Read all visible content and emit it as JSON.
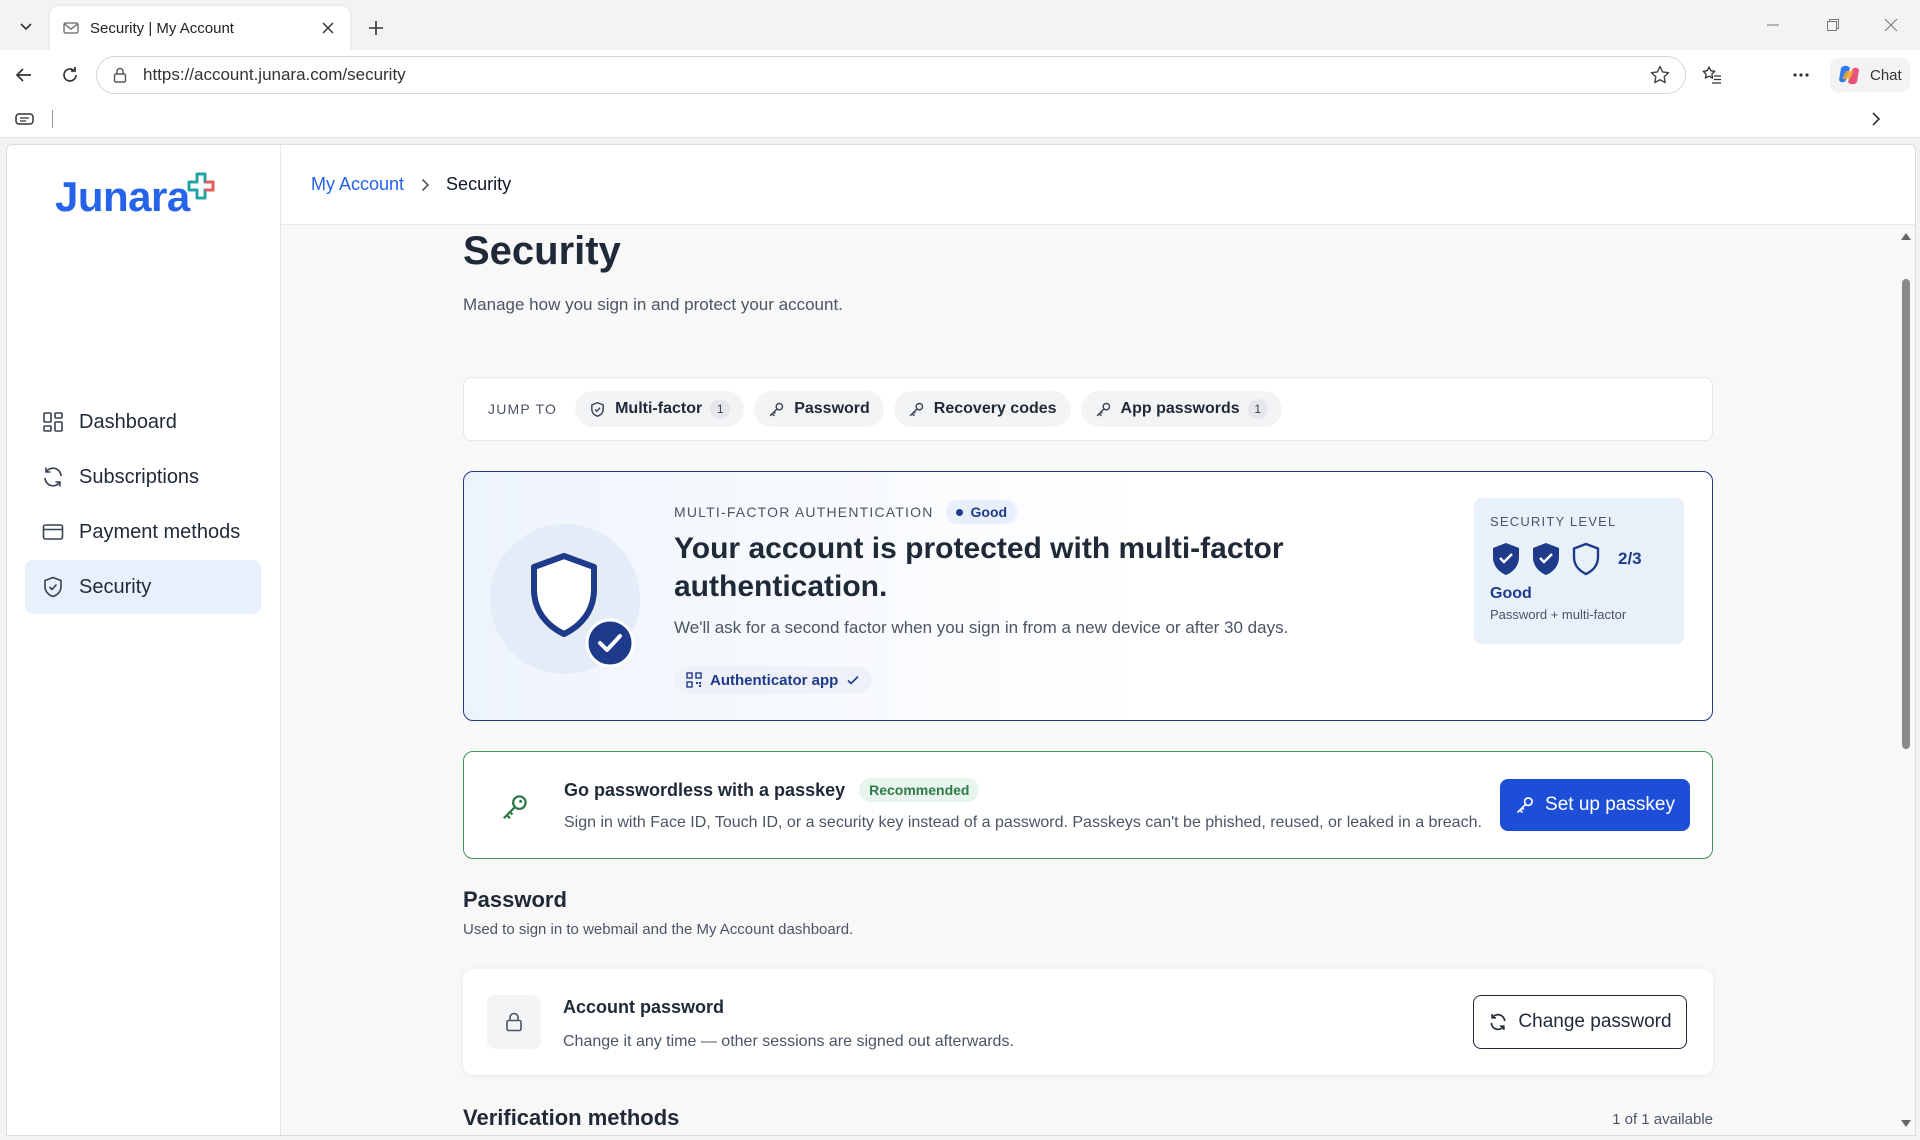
{
  "browser": {
    "tab_title": "Security | My Account",
    "url": "https://account.junara.com/security",
    "chat_label": "Chat"
  },
  "sidebar": {
    "logo_text": "Junara",
    "items": [
      {
        "label": "Dashboard",
        "icon": "dashboard-icon"
      },
      {
        "label": "Subscriptions",
        "icon": "refresh-icon"
      },
      {
        "label": "Payment methods",
        "icon": "card-icon"
      },
      {
        "label": "Security",
        "icon": "shield-icon",
        "active": true
      }
    ]
  },
  "breadcrumb": {
    "parent": "My Account",
    "current": "Security"
  },
  "header": {
    "title": "Security",
    "subtitle": "Manage how you sign in and protect your account."
  },
  "jump": {
    "label": "JUMP TO",
    "chips": [
      {
        "label": "Multi-factor",
        "count": "1",
        "icon": "shield-icon"
      },
      {
        "label": "Password",
        "icon": "key-icon"
      },
      {
        "label": "Recovery codes",
        "icon": "key-icon"
      },
      {
        "label": "App passwords",
        "count": "1",
        "icon": "key-icon"
      }
    ]
  },
  "mfa": {
    "eyebrow": "MULTI-FACTOR AUTHENTICATION",
    "status": "Good",
    "title": "Your account is protected with multi-factor authentication.",
    "description": "We'll ask for a second factor when you sign in from a new device or after 30 days.",
    "method": "Authenticator app",
    "level": {
      "eyebrow": "SECURITY LEVEL",
      "score": "2/3",
      "filled": 2,
      "total": 3,
      "label": "Good",
      "note": "Password + multi-factor"
    }
  },
  "passkey": {
    "title": "Go passwordless with a passkey",
    "badge": "Recommended",
    "description": "Sign in with Face ID, Touch ID, or a security key instead of a password. Passkeys can't be phished, reused, or leaked in a breach.",
    "button": "Set up passkey"
  },
  "password": {
    "section_title": "Password",
    "section_sub": "Used to sign in to webmail and the My Account dashboard.",
    "card_title": "Account password",
    "card_desc": "Change it any time — other sessions are signed out afterwards.",
    "button": "Change password"
  },
  "verification": {
    "section_title": "Verification methods",
    "available": "1 of 1 available"
  },
  "colors": {
    "accent": "#2563eb",
    "navy": "#1e3a8a",
    "success": "#2f7a4a",
    "primary_button": "#1d4ed8"
  }
}
